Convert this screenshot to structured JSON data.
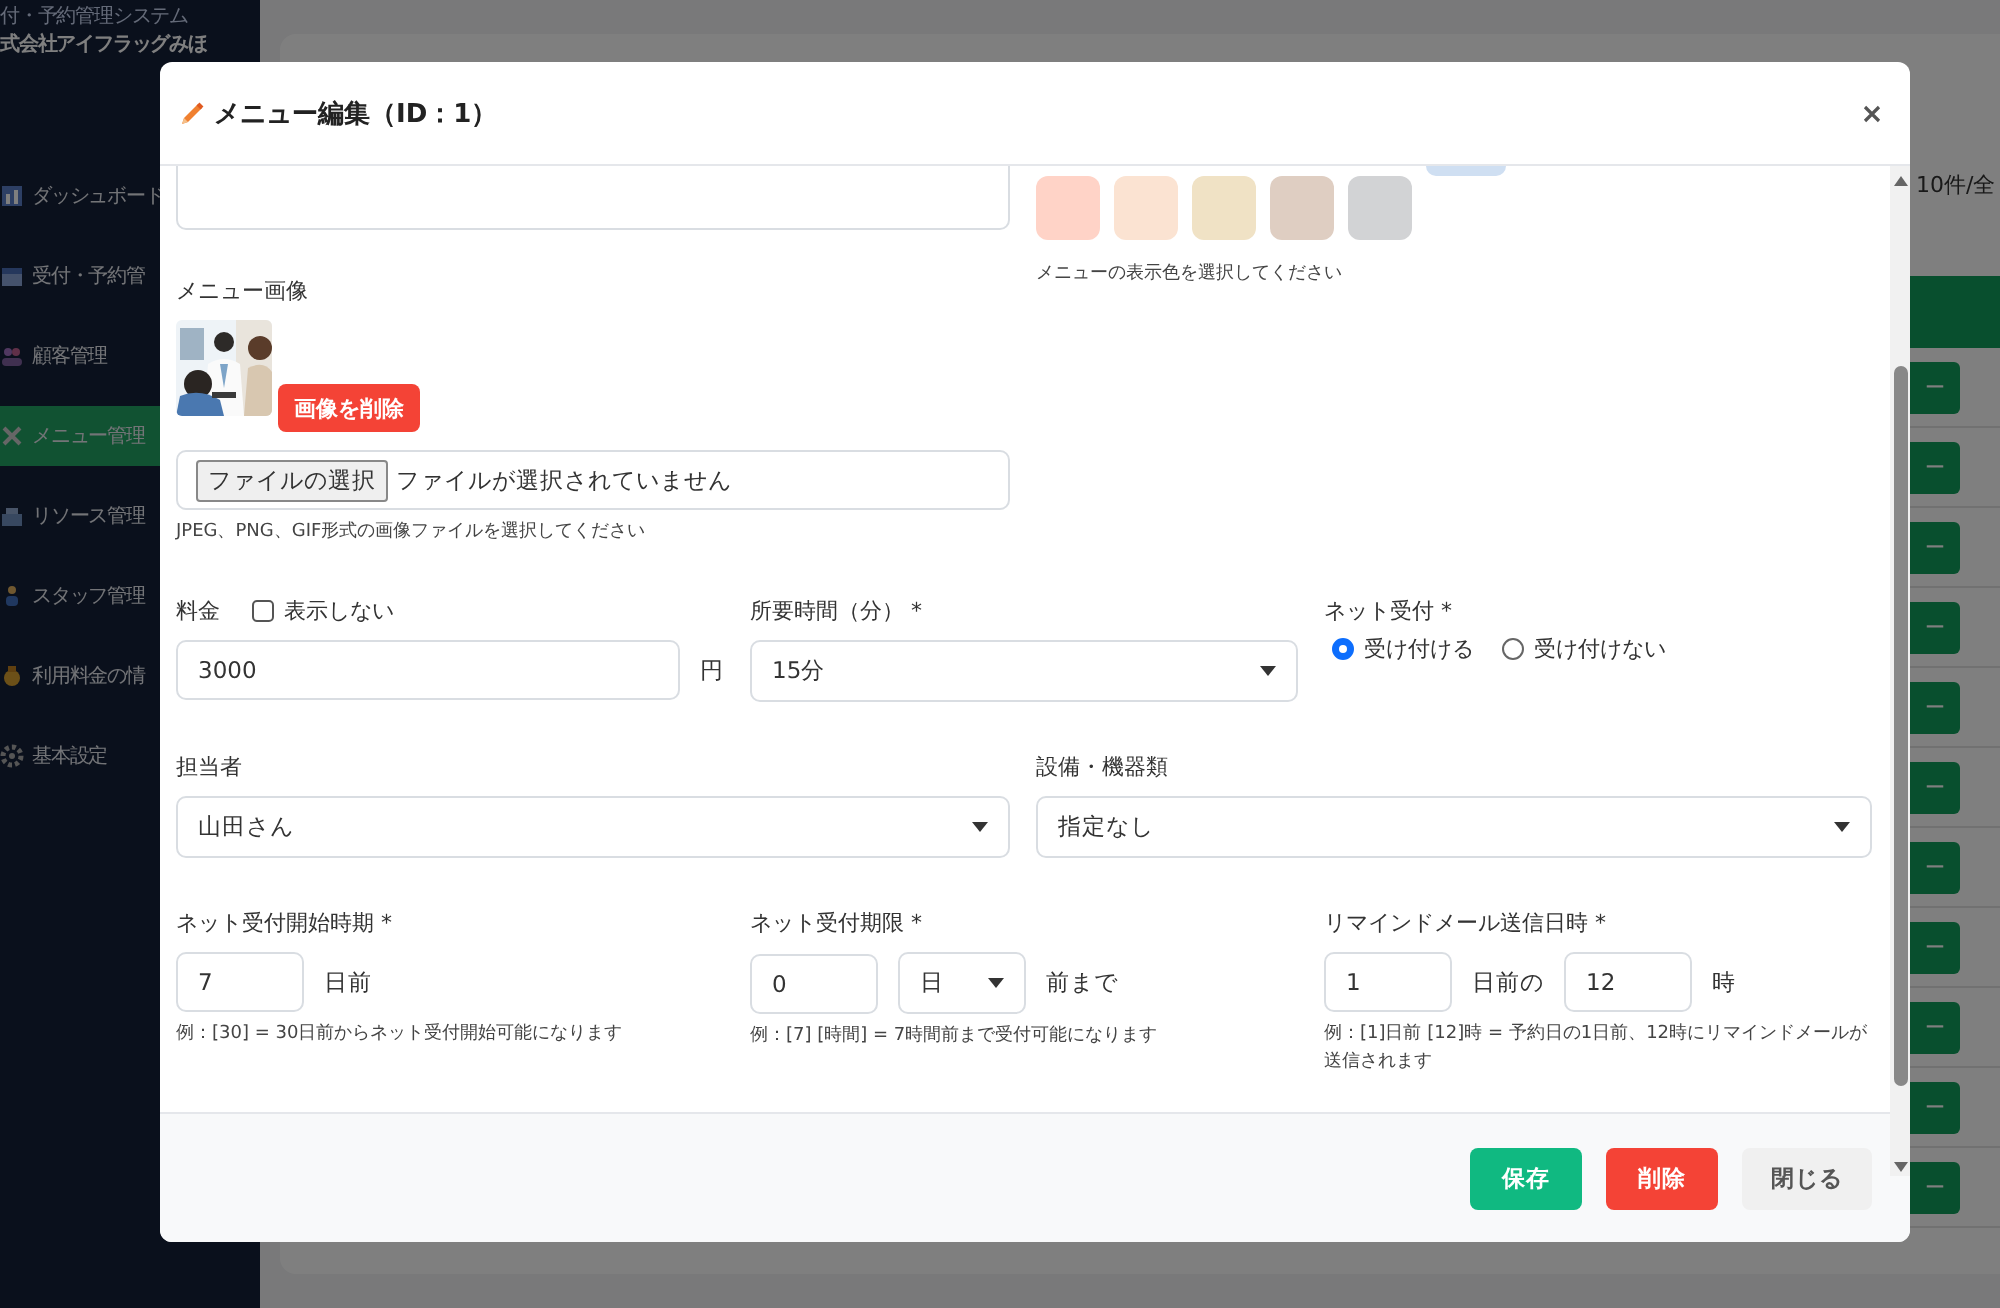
{
  "sidebar": {
    "system_name": "付・予約管理システム",
    "company": "式会社アイフラッグみほ",
    "items": [
      {
        "label": "ダッシュボード",
        "selected": false
      },
      {
        "label": "受付・予約管",
        "selected": false
      },
      {
        "label": "顧客管理",
        "selected": false
      },
      {
        "label": "メニュー管理",
        "selected": true
      },
      {
        "label": "リソース管理",
        "selected": false
      },
      {
        "label": "スタッフ管理",
        "selected": false
      },
      {
        "label": "利用料金の情",
        "selected": false
      },
      {
        "label": "基本設定",
        "selected": false
      }
    ]
  },
  "background": {
    "page_info": "10件/全",
    "row_buttons": [
      "ー",
      "ー",
      "ー",
      "ー",
      "ー",
      "ー",
      "ー",
      "ー",
      "ー",
      "ー",
      "ー"
    ]
  },
  "modal": {
    "title": "メニュー編集（ID：1）",
    "colors": [
      {
        "color": "#cfdff2",
        "kind": "clipped"
      },
      {
        "color": "#ffd3c7",
        "kind": "swatch"
      },
      {
        "color": "#fbe3d2",
        "kind": "swatch"
      },
      {
        "color": "#f0e2c5",
        "kind": "swatch"
      },
      {
        "color": "#dfcec2",
        "kind": "swatch"
      },
      {
        "color": "#d2d3d5",
        "kind": "swatch"
      }
    ],
    "color_hint": "メニューの表示色を選択してください",
    "image_label": "メニュー画像",
    "delete_image": "画像を削除",
    "file_button": "ファイルの選択",
    "file_status": "ファイルが選択されていません",
    "file_hint": "JPEG、PNG、GIF形式の画像ファイルを選択してください",
    "price": {
      "label": "料金",
      "hide_label": "表示しない",
      "hide_checked": false,
      "value": "3000",
      "unit": "円"
    },
    "duration": {
      "label": "所要時間（分） *",
      "value": "15分"
    },
    "online": {
      "label": "ネット受付 *",
      "options": [
        {
          "label": "受け付ける",
          "selected": true
        },
        {
          "label": "受け付けない",
          "selected": false
        }
      ]
    },
    "staff": {
      "label": "担当者",
      "value": "山田さん"
    },
    "equipment": {
      "label": "設備・機器類",
      "value": "指定なし"
    },
    "start": {
      "label": "ネット受付開始時期 *",
      "value": "7",
      "suffix": "日前",
      "hint": "例：[30] = 30日前からネット受付開始可能になります"
    },
    "deadline": {
      "label": "ネット受付期限 *",
      "value": "0",
      "unit": "日",
      "suffix": "前まで",
      "hint": "例：[7] [時間] = 7時間前まで受付可能になります"
    },
    "reminder": {
      "label": "リマインドメール送信日時 *",
      "days": "1",
      "days_suffix": "日前の",
      "hour": "12",
      "hour_suffix": "時",
      "hint": "例：[1]日前 [12]時 = 予約日の1日前、12時にリマインドメールが送信されます"
    },
    "buttons": [
      {
        "label": "保存",
        "kind": "save"
      },
      {
        "label": "削除",
        "kind": "delete"
      },
      {
        "label": "閉じる",
        "kind": "close"
      }
    ]
  }
}
